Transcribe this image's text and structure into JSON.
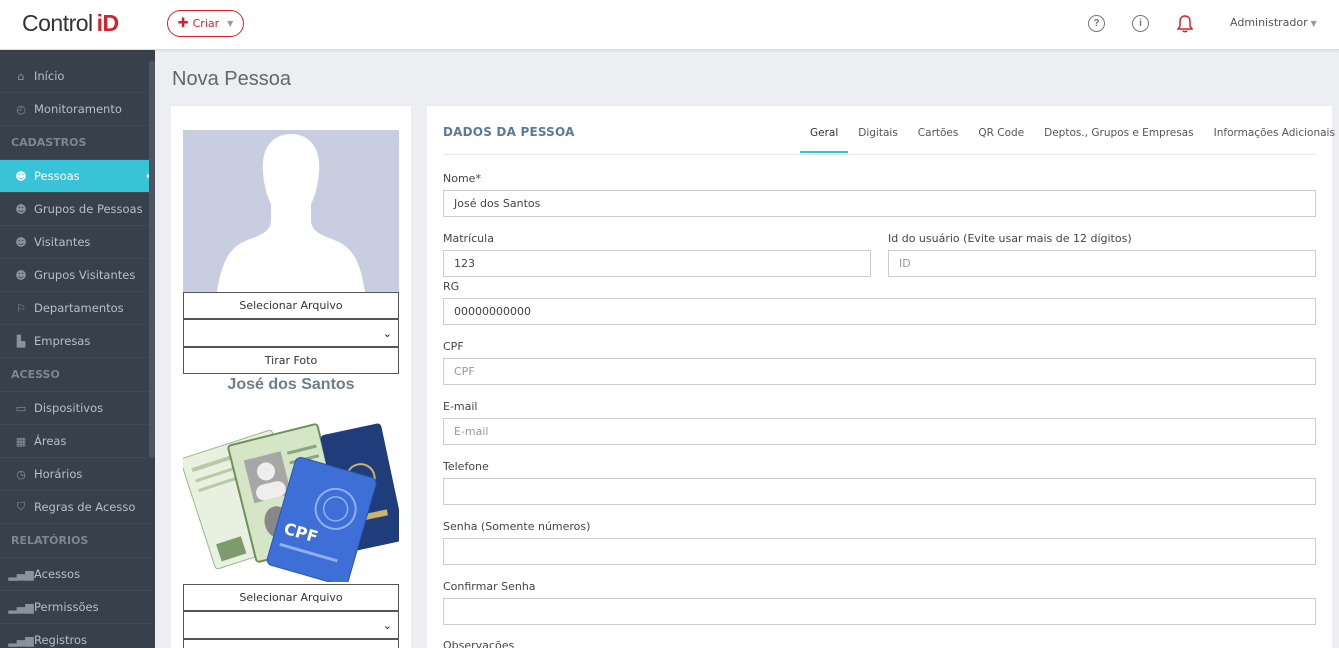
{
  "header": {
    "logo_text": "Control",
    "logo_accent": "iD",
    "create_label": "Criar",
    "help_icon": "?",
    "info_icon": "i",
    "user_label": "Administrador"
  },
  "sidebar": {
    "items_top": [
      {
        "label": "Início",
        "icon": "home-icon"
      },
      {
        "label": "Monitoramento",
        "icon": "gauge-icon"
      }
    ],
    "section_cadastros": "CADASTROS",
    "items_cadastros": [
      {
        "label": "Pessoas",
        "icon": "user-icon"
      },
      {
        "label": "Grupos de Pessoas",
        "icon": "users-icon"
      },
      {
        "label": "Visitantes",
        "icon": "user-icon"
      },
      {
        "label": "Grupos Visitantes",
        "icon": "users-icon"
      },
      {
        "label": "Departamentos",
        "icon": "signpost-icon"
      },
      {
        "label": "Empresas",
        "icon": "industry-icon"
      }
    ],
    "section_acesso": "ACESSO",
    "items_acesso": [
      {
        "label": "Dispositivos",
        "icon": "monitor-icon"
      },
      {
        "label": "Áreas",
        "icon": "building-icon"
      },
      {
        "label": "Horários",
        "icon": "clock-icon"
      },
      {
        "label": "Regras de Acesso",
        "icon": "shield-icon"
      }
    ],
    "section_relatorios": "RELATÓRIOS",
    "items_relatorios": [
      {
        "label": "Acessos",
        "icon": "bar-chart-icon"
      },
      {
        "label": "Permissões",
        "icon": "bar-chart-icon"
      },
      {
        "label": "Registros",
        "icon": "bar-chart-icon"
      }
    ]
  },
  "page": {
    "title": "Nova Pessoa"
  },
  "photo_panel": {
    "select_file_label": "Selecionar Arquivo",
    "take_photo_label": "Tirar Foto",
    "person_name": "José dos Santos",
    "select_file_label_2": "Selecionar Arquivo"
  },
  "form": {
    "section_title": "DADOS DA PESSOA",
    "tabs": [
      "Geral",
      "Digitais",
      "Cartões",
      "QR Code",
      "Deptos., Grupos e Empresas",
      "Informações Adicionais"
    ],
    "active_tab": "Geral",
    "nome_label": "Nome*",
    "nome_value": "José dos Santos",
    "matricula_label": "Matrícula",
    "matricula_value": "123",
    "id_label": "Id do usuário (Evite usar mais de 12 dígitos)",
    "id_placeholder": "ID",
    "rg_label": "RG",
    "rg_value": "00000000000",
    "cpf_label": "CPF",
    "cpf_placeholder": "CPF",
    "email_label": "E-mail",
    "email_placeholder": "E-mail",
    "telefone_label": "Telefone",
    "telefone_value": "",
    "senha_label": "Senha (Somente números)",
    "senha_value": "",
    "confirmar_label": "Confirmar Senha",
    "confirmar_value": "",
    "observacoes_label": "Observações"
  },
  "colors": {
    "brand_red": "#d6202a",
    "accent_cyan": "#38c3d9",
    "sidebar_bg": "#37404b"
  }
}
